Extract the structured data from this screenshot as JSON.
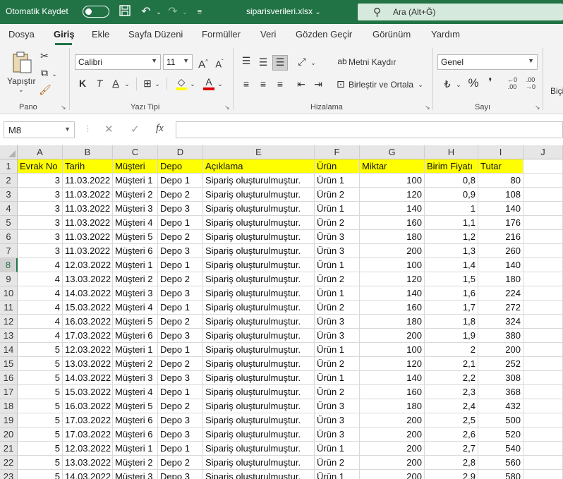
{
  "titlebar": {
    "autosave_label": "Otomatik Kaydet",
    "filename": "siparisverileri.xlsx",
    "filename_chevron": "⌄",
    "search_placeholder": "Ara (Alt+Ğ)",
    "accent": "#217346"
  },
  "tabs": [
    "Dosya",
    "Giriş",
    "Ekle",
    "Sayfa Düzeni",
    "Formüller",
    "Veri",
    "Gözden Geçir",
    "Görünüm",
    "Yardım"
  ],
  "active_tab": "Giriş",
  "ribbon": {
    "clipboard": {
      "paste_label": "Yapıştır",
      "group_label": "Pano"
    },
    "font": {
      "font_name": "Calibri",
      "font_size": "11",
      "group_label": "Yazı Tipi"
    },
    "alignment": {
      "wrap_text": "Metni Kaydır",
      "merge_center": "Birleştir ve Ortala",
      "group_label": "Hizalama"
    },
    "number": {
      "format": "Genel",
      "group_label": "Sayı",
      "percent": "%",
      "comma": "❜"
    },
    "cut_off_label": "Biçi"
  },
  "formula_bar": {
    "name_box": "M8",
    "fx": "fx",
    "formula": ""
  },
  "columns": [
    "A",
    "B",
    "C",
    "D",
    "E",
    "F",
    "G",
    "H",
    "I",
    "J"
  ],
  "header_fill": "#ffff00",
  "table": {
    "headers": [
      "Evrak No",
      "Tarih",
      "Müşteri",
      "Depo",
      "Açıklama",
      "Ürün",
      "Miktar",
      "Birim Fiyatı",
      "Tutar"
    ],
    "rows": [
      [
        "2",
        "3",
        "11.03.2022",
        "Müşteri 1",
        "Depo 1",
        "Sipariş oluşturulmuştur.",
        "Ürün 1",
        "100",
        "0,8",
        "80"
      ],
      [
        "3",
        "3",
        "11.03.2022",
        "Müşteri 2",
        "Depo 2",
        "Sipariş oluşturulmuştur.",
        "Ürün 2",
        "120",
        "0,9",
        "108"
      ],
      [
        "4",
        "3",
        "11.03.2022",
        "Müşteri 3",
        "Depo 3",
        "Sipariş oluşturulmuştur.",
        "Ürün 1",
        "140",
        "1",
        "140"
      ],
      [
        "5",
        "3",
        "11.03.2022",
        "Müşteri 4",
        "Depo 1",
        "Sipariş oluşturulmuştur.",
        "Ürün 2",
        "160",
        "1,1",
        "176"
      ],
      [
        "6",
        "3",
        "11.03.2022",
        "Müşteri 5",
        "Depo 2",
        "Sipariş oluşturulmuştur.",
        "Ürün 3",
        "180",
        "1,2",
        "216"
      ],
      [
        "7",
        "3",
        "11.03.2022",
        "Müşteri 6",
        "Depo 3",
        "Sipariş oluşturulmuştur.",
        "Ürün 3",
        "200",
        "1,3",
        "260"
      ],
      [
        "8",
        "4",
        "12.03.2022",
        "Müşteri 1",
        "Depo 1",
        "Sipariş oluşturulmuştur.",
        "Ürün 1",
        "100",
        "1,4",
        "140"
      ],
      [
        "9",
        "4",
        "13.03.2022",
        "Müşteri 2",
        "Depo 2",
        "Sipariş oluşturulmuştur.",
        "Ürün 2",
        "120",
        "1,5",
        "180"
      ],
      [
        "10",
        "4",
        "14.03.2022",
        "Müşteri 3",
        "Depo 3",
        "Sipariş oluşturulmuştur.",
        "Ürün 1",
        "140",
        "1,6",
        "224"
      ],
      [
        "11",
        "4",
        "15.03.2022",
        "Müşteri 4",
        "Depo 1",
        "Sipariş oluşturulmuştur.",
        "Ürün 2",
        "160",
        "1,7",
        "272"
      ],
      [
        "12",
        "4",
        "16.03.2022",
        "Müşteri 5",
        "Depo 2",
        "Sipariş oluşturulmuştur.",
        "Ürün 3",
        "180",
        "1,8",
        "324"
      ],
      [
        "13",
        "4",
        "17.03.2022",
        "Müşteri 6",
        "Depo 3",
        "Sipariş oluşturulmuştur.",
        "Ürün 3",
        "200",
        "1,9",
        "380"
      ],
      [
        "14",
        "5",
        "12.03.2022",
        "Müşteri 1",
        "Depo 1",
        "Sipariş oluşturulmuştur.",
        "Ürün 1",
        "100",
        "2",
        "200"
      ],
      [
        "15",
        "5",
        "13.03.2022",
        "Müşteri 2",
        "Depo 2",
        "Sipariş oluşturulmuştur.",
        "Ürün 2",
        "120",
        "2,1",
        "252"
      ],
      [
        "16",
        "5",
        "14.03.2022",
        "Müşteri 3",
        "Depo 3",
        "Sipariş oluşturulmuştur.",
        "Ürün 1",
        "140",
        "2,2",
        "308"
      ],
      [
        "17",
        "5",
        "15.03.2022",
        "Müşteri 4",
        "Depo 1",
        "Sipariş oluşturulmuştur.",
        "Ürün 2",
        "160",
        "2,3",
        "368"
      ],
      [
        "18",
        "5",
        "16.03.2022",
        "Müşteri 5",
        "Depo 2",
        "Sipariş oluşturulmuştur.",
        "Ürün 3",
        "180",
        "2,4",
        "432"
      ],
      [
        "19",
        "5",
        "17.03.2022",
        "Müşteri 6",
        "Depo 3",
        "Sipariş oluşturulmuştur.",
        "Ürün 3",
        "200",
        "2,5",
        "500"
      ],
      [
        "20",
        "5",
        "17.03.2022",
        "Müşteri 6",
        "Depo 3",
        "Sipariş oluşturulmuştur.",
        "Ürün 3",
        "200",
        "2,6",
        "520"
      ],
      [
        "21",
        "5",
        "12.03.2022",
        "Müşteri 1",
        "Depo 1",
        "Sipariş oluşturulmuştur.",
        "Ürün 1",
        "200",
        "2,7",
        "540"
      ],
      [
        "22",
        "5",
        "13.03.2022",
        "Müşteri 2",
        "Depo 2",
        "Sipariş oluşturulmuştur.",
        "Ürün 2",
        "200",
        "2,8",
        "560"
      ],
      [
        "23",
        "5",
        "14.03.2022",
        "Müşteri 3",
        "Depo 3",
        "Sipariş oluşturulmuştur.",
        "Ürün 1",
        "200",
        "2,9",
        "580"
      ]
    ]
  },
  "selected_row": "8"
}
